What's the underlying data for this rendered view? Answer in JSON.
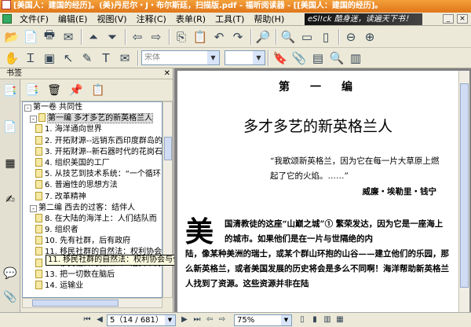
{
  "window": {
    "title": "[美国人：建国的经历]。(美)丹尼尔・J・布尔斯廷，扫描版.pdf - 福昕阅读器 - [[美国人：建国的经历]。"
  },
  "menu": {
    "items": [
      "文件(F)",
      "编辑(E)",
      "视图(V)",
      "注释(C)",
      "表单(R)",
      "工具(T)",
      "帮助(H)"
    ],
    "ad_text": "eSl!ck 酷身迷，读遍天下书！"
  },
  "toolbar": {
    "font_combo_placeholder": "宋体"
  },
  "left_panel": {
    "header": "书签",
    "close_label": "✕",
    "bookmarks": [
      {
        "label": "第一卷 共同性",
        "level": 0,
        "expander": "-",
        "icon": false
      },
      {
        "label": "第一编 多才多艺的新英格兰人",
        "level": 1,
        "expander": "-",
        "icon": true,
        "selected": true
      },
      {
        "label": "1. 海洋通向世界",
        "level": 2,
        "icon": true
      },
      {
        "label": "2. 开拓财源--远销东西印度群岛的",
        "level": 2,
        "icon": true
      },
      {
        "label": "3. 开拓财源--新石器时代的花岗石",
        "level": 2,
        "icon": true
      },
      {
        "label": "4. 组织美国的工厂",
        "level": 2,
        "icon": true
      },
      {
        "label": "5. 从技艺到技术系统：“一个循环",
        "level": 2,
        "icon": true
      },
      {
        "label": "6. 普遍性的思想方法",
        "level": 2,
        "icon": true
      },
      {
        "label": "7. 改革精神",
        "level": 2,
        "icon": true
      },
      {
        "label": "第二编 西去的过客：结伴人",
        "level": 1,
        "expander": "-",
        "icon": false
      },
      {
        "label": "8. 在大陆的海洋上：人们结队而",
        "level": 2,
        "icon": true
      },
      {
        "label": "9. 组织者",
        "level": 2,
        "icon": true
      },
      {
        "label": "10. 先有社群，后有政府",
        "level": 2,
        "icon": true
      },
      {
        "label": "11. 移民社群的自然法：权利协会与优先权原则",
        "level": 2,
        "icon": true
      },
      {
        "label": "12. 移民社群的自然法：治安维持",
        "level": 2,
        "icon": true
      },
      {
        "label": "13. 把一切数在脑后",
        "level": 2,
        "icon": true
      },
      {
        "label": "14. 运输业",
        "level": 2,
        "icon": true
      }
    ],
    "tooltip": "11. 移民社群的自然法：权利协会与优先权原则"
  },
  "document": {
    "chapter_heading": "第　一　编",
    "title": "多才多艺的新英格兰人",
    "quote": "“我歌颂新英格兰，因为它在每一片大草原上燃起了它的火焰。……”",
    "quote_author": "威廉・埃勒里・钱宁",
    "dropcap": "美",
    "para1": "国清教徒的这座“山巅之城”① 繁荣发达，因为它是一座海上的城市。如果他们是在一片与世隔绝的内",
    "para2": "陆，像某种美洲的瑞士，或某个群山环抱的山谷——建立他们的乐园，那么新英格兰，或者美国发展的历史将会是多么不同啊！海洋帮助新英格兰人找到了资源。这些资源并非在陆"
  },
  "statusbar": {
    "page_value": "5（14 / 681）",
    "zoom_value": "75%"
  }
}
